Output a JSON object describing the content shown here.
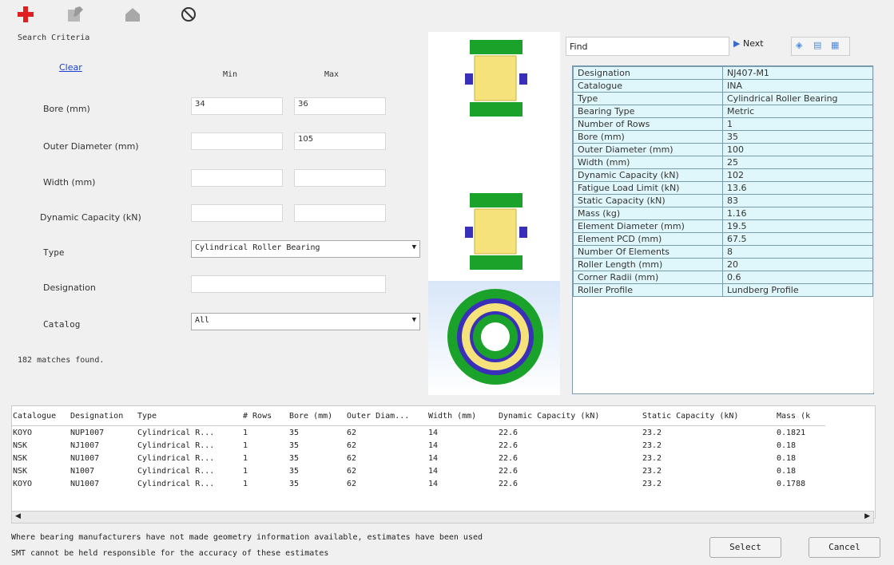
{
  "toolbar": {
    "icons": [
      "add-icon",
      "edit-icon",
      "home-icon",
      "clear-icon"
    ]
  },
  "search": {
    "title": "Search Criteria",
    "clear_label": "Clear",
    "min_label": "Min",
    "max_label": "Max",
    "bore_label": "Bore (mm)",
    "bore_min": "34",
    "bore_max": "36",
    "outer_label": "Outer Diameter (mm)",
    "outer_min": "",
    "outer_max": "105",
    "width_label": "Width (mm)",
    "width_min": "",
    "width_max": "",
    "dyn_label": "Dynamic Capacity (kN)",
    "dyn_min": "",
    "dyn_max": "",
    "type_label": "Type",
    "type_value": "Cylindrical Roller Bearing",
    "designation_label": "Designation",
    "designation_value": "",
    "catalog_label": "Catalog",
    "catalog_value": "All",
    "matches": "182 matches found."
  },
  "find": {
    "label": "Find",
    "value": "",
    "next_label": "Next"
  },
  "properties": [
    {
      "k": "Designation",
      "v": "NJ407-M1"
    },
    {
      "k": "Catalogue",
      "v": "INA"
    },
    {
      "k": "Type",
      "v": "Cylindrical Roller Bearing"
    },
    {
      "k": "Bearing Type",
      "v": "Metric"
    },
    {
      "k": "Number of Rows",
      "v": "1"
    },
    {
      "k": "Bore (mm)",
      "v": "35"
    },
    {
      "k": "Outer Diameter (mm)",
      "v": "100"
    },
    {
      "k": "Width (mm)",
      "v": "25"
    },
    {
      "k": "Dynamic Capacity (kN)",
      "v": "102"
    },
    {
      "k": "Fatigue Load Limit (kN)",
      "v": "13.6"
    },
    {
      "k": "Static Capacity (kN)",
      "v": "83"
    },
    {
      "k": "Mass (kg)",
      "v": "1.16"
    },
    {
      "k": "Element Diameter (mm)",
      "v": "19.5"
    },
    {
      "k": "Element PCD (mm)",
      "v": "67.5"
    },
    {
      "k": "Number Of Elements",
      "v": "8"
    },
    {
      "k": "Roller Length (mm)",
      "v": "20"
    },
    {
      "k": "Corner Radii (mm)",
      "v": "0.6"
    },
    {
      "k": "Roller Profile",
      "v": "Lundberg Profile"
    }
  ],
  "grid": {
    "columns": [
      "Catalogue",
      "Designation",
      "Type",
      "# Rows",
      "Bore (mm)",
      "Outer Diam...",
      "Width (mm)",
      "Dynamic Capacity (kN)",
      "Static Capacity (kN)",
      "Mass (k"
    ],
    "rows": [
      [
        "KOYO",
        "NUP1007",
        "Cylindrical R...",
        "1",
        "35",
        "62",
        "14",
        "22.6",
        "23.2",
        "0.1821"
      ],
      [
        "NSK",
        "NJ1007",
        "Cylindrical R...",
        "1",
        "35",
        "62",
        "14",
        "22.6",
        "23.2",
        "0.18"
      ],
      [
        "NSK",
        "NU1007",
        "Cylindrical R...",
        "1",
        "35",
        "62",
        "14",
        "22.6",
        "23.2",
        "0.18"
      ],
      [
        "NSK",
        "N1007",
        "Cylindrical R...",
        "1",
        "35",
        "62",
        "14",
        "22.6",
        "23.2",
        "0.18"
      ],
      [
        "KOYO",
        "NU1007",
        "Cylindrical R...",
        "1",
        "35",
        "62",
        "14",
        "22.6",
        "23.2",
        "0.1788"
      ]
    ]
  },
  "footer": {
    "line1": "Where bearing manufacturers have not made geometry information available, estimates have been used",
    "line2": "SMT cannot be held responsible for the accuracy of these estimates",
    "select_label": "Select",
    "cancel_label": "Cancel"
  },
  "colors": {
    "cell_bg": "#dff7fb",
    "bearing_green": "#1aa22a",
    "bearing_yellow": "#f6e27a",
    "bearing_blue": "#3a2fb8"
  }
}
